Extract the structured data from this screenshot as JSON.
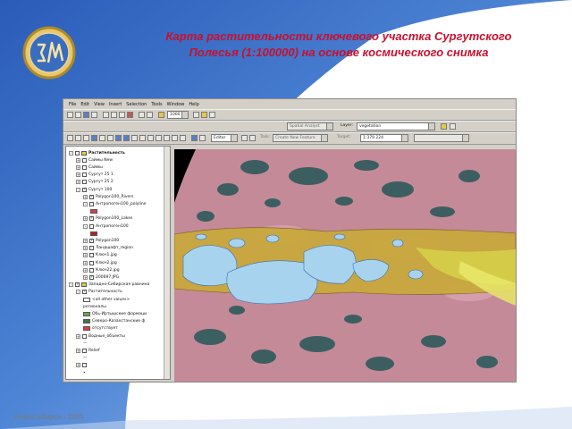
{
  "slide": {
    "title_line1": "Карта растительности ключевого участка Сургутского",
    "title_line2": "Полесья (1:100000) на основе космического снимка",
    "footer": "Новосибирск - 2005",
    "colors": {
      "title": "#c8102e",
      "bg_blue": "#2f5fb3",
      "footer": "#6f7f94"
    }
  },
  "app": {
    "menu": [
      "File",
      "Edit",
      "View",
      "Insert",
      "Selection",
      "Tools",
      "Window",
      "Help"
    ],
    "toolbar": {
      "scale_value": "1000",
      "spatial_analyst_label": "Spatial Analyst",
      "layer_label": "Layer:",
      "layer_value": "vegetation",
      "map_scale": "1:379 224",
      "editor_label": "Editor",
      "task_label": "Task:",
      "task_value": "Create New Feature",
      "target_label": "Target:"
    },
    "toc": [
      {
        "label": "Растительность",
        "level": 0,
        "expander": "-",
        "check": false,
        "icon": "layers-icon",
        "bold": true
      },
      {
        "label": "Саймы New",
        "level": 1,
        "expander": "+",
        "check": false
      },
      {
        "label": "Саймы",
        "level": 1,
        "expander": "+",
        "check": false
      },
      {
        "label": "Сургут 25 1",
        "level": 1,
        "expander": "+",
        "check": false
      },
      {
        "label": "Сургут 25 2",
        "level": 1,
        "expander": "+",
        "check": false
      },
      {
        "label": "Сургут 100",
        "level": 1,
        "expander": "-",
        "check": true
      },
      {
        "label": "Polygon100_Rivers",
        "level": 2,
        "expander": "+",
        "check": true
      },
      {
        "label": "Антропоген100_polyline",
        "level": 2,
        "expander": "-",
        "check": false
      },
      {
        "label": "",
        "level": 3,
        "swatch": "#d84040"
      },
      {
        "label": "Polygon100_Lakes",
        "level": 2,
        "expander": "+",
        "check": true
      },
      {
        "label": "Антропоген100",
        "level": 2,
        "expander": "-",
        "check": false
      },
      {
        "label": "",
        "level": 3,
        "swatch": "#c81818"
      },
      {
        "label": "Polygon100",
        "level": 2,
        "expander": "+",
        "check": true
      },
      {
        "label": "Ландшафт_region",
        "level": 2,
        "expander": "+",
        "check": false
      },
      {
        "label": "Ключ1.jpg",
        "level": 2,
        "expander": "+",
        "check": false
      },
      {
        "label": "Ключ2.jpg",
        "level": 2,
        "expander": "+",
        "check": false
      },
      {
        "label": "Ключ22.jpg",
        "level": 2,
        "expander": "+",
        "check": false
      },
      {
        "label": "200697.JPG",
        "level": 2,
        "expander": "+",
        "check": true
      },
      {
        "label": "Западно-Сибирская равнина",
        "level": 0,
        "expander": "-",
        "check": true,
        "icon": "layers-icon"
      },
      {
        "label": "Растительность",
        "level": 1,
        "expander": "-",
        "check": true
      },
      {
        "label": "<all other values>",
        "level": 2,
        "swatch": "#ffffff"
      },
      {
        "label": "регионалы",
        "level": 2
      },
      {
        "label": "Обь-Иртышские формаци",
        "level": 2,
        "swatch": "#6aa84f"
      },
      {
        "label": "Северо-Казахстанские ф",
        "level": 2,
        "swatch": "#3d7a3d"
      },
      {
        "label": "отсутствует",
        "level": 2,
        "swatch": "#e03c3c"
      },
      {
        "label": "Водные_объекты",
        "level": 1,
        "expander": "+",
        "check": false
      },
      {
        "label": "—",
        "level": 2
      },
      {
        "label": "Relief",
        "level": 1,
        "expander": "+",
        "check": false
      },
      {
        "label": "—",
        "level": 2
      },
      {
        "label": "",
        "level": 1,
        "expander": "+",
        "check": false
      },
      {
        "label": "•",
        "level": 2
      }
    ]
  }
}
